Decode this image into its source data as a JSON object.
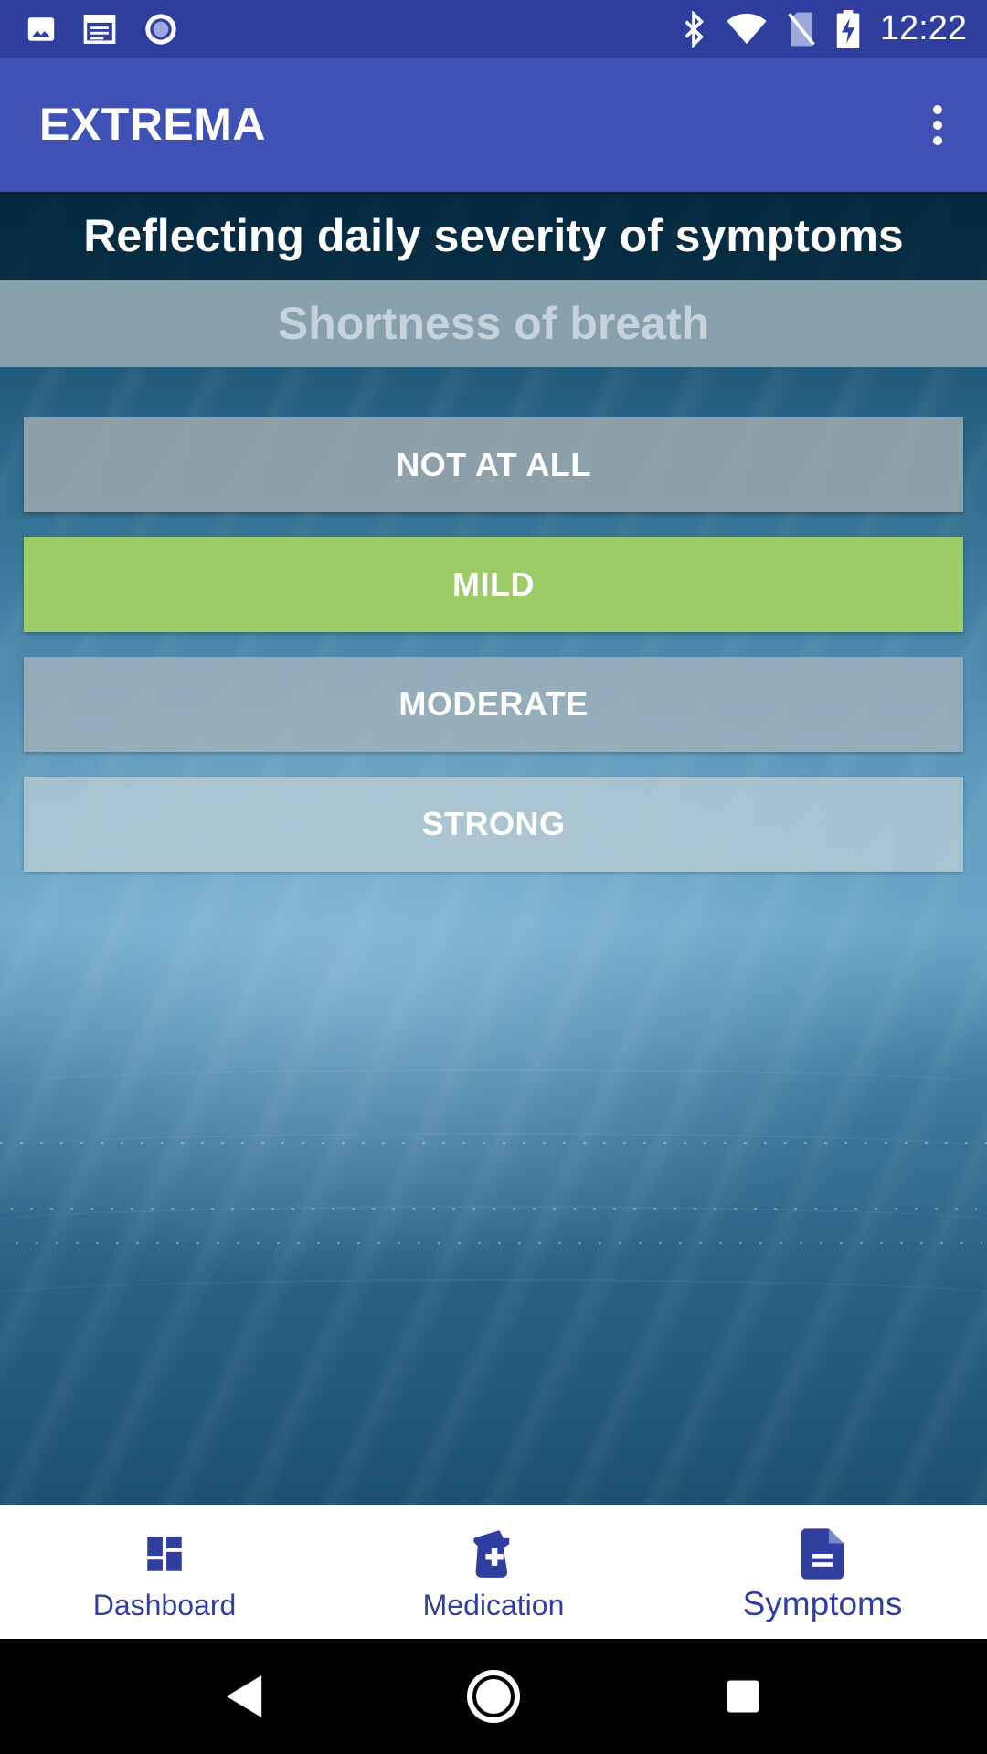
{
  "status_bar": {
    "time": "12:22",
    "left_icons": [
      "image-icon",
      "calendar-icon",
      "circle-notification-icon"
    ],
    "right_icons": [
      "bluetooth-icon",
      "wifi-icon",
      "no-sim-icon",
      "battery-charging-icon"
    ]
  },
  "app_bar": {
    "title": "EXTREMA",
    "menu_icon": "overflow-menu-icon"
  },
  "main": {
    "heading": "Reflecting daily severity of symptoms",
    "symptom": "Shortness of breath",
    "options": [
      {
        "label": "NOT AT ALL",
        "selected": false
      },
      {
        "label": "MILD",
        "selected": true
      },
      {
        "label": "MODERATE",
        "selected": false
      },
      {
        "label": "STRONG",
        "selected": false
      }
    ],
    "colors": {
      "selected": "#9ccc65",
      "heading_band": "#04263a",
      "accent": "#3f51b5"
    }
  },
  "bottom_nav": {
    "items": [
      {
        "label": "Dashboard",
        "icon": "dashboard-icon",
        "active": false
      },
      {
        "label": "Medication",
        "icon": "medication-icon",
        "active": false
      },
      {
        "label": "Symptoms",
        "icon": "document-icon",
        "active": true
      }
    ]
  },
  "system_nav": {
    "buttons": [
      "back-icon",
      "home-icon",
      "recents-icon"
    ]
  }
}
